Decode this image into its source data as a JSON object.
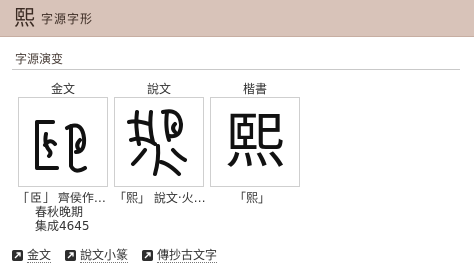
{
  "header": {
    "glyph": "熙",
    "title": "字源字形",
    "icon": "glyph-logo"
  },
  "section": {
    "title": "字源演变"
  },
  "columns": [
    {
      "label": "金文",
      "caption_lines": [
        "「𦣞」 齊侯作…",
        "春秋晚期",
        "集成4645"
      ]
    },
    {
      "label": "說文",
      "caption_lines": [
        "「熙」 說文‧火…"
      ]
    },
    {
      "label": "楷書",
      "caption_lines": [
        "「熙」"
      ],
      "glyph": "熙"
    }
  ],
  "links": [
    {
      "label": "金文",
      "icon": "external-link-icon"
    },
    {
      "label": "說文小篆",
      "icon": "external-link-icon"
    },
    {
      "label": "傳抄古文字",
      "icon": "external-link-icon"
    }
  ]
}
